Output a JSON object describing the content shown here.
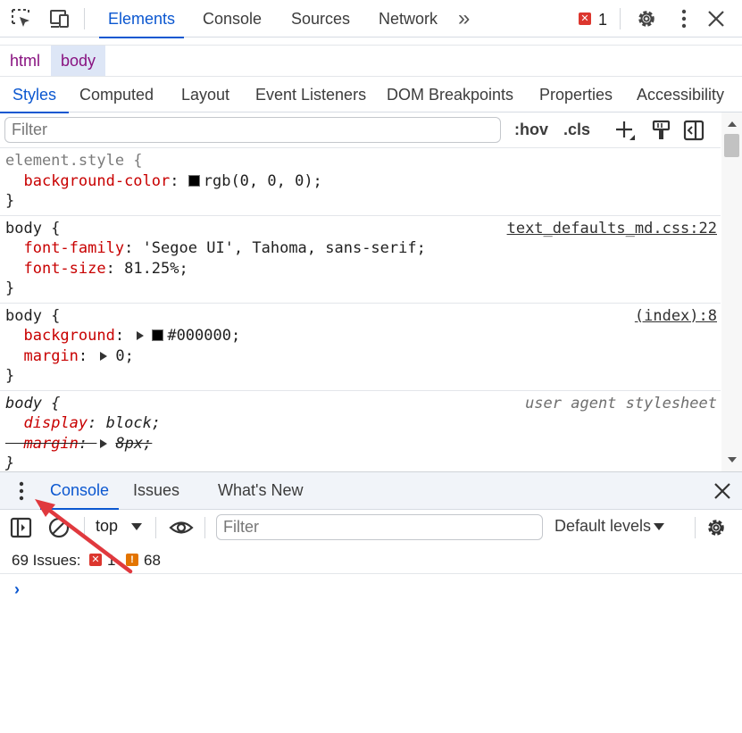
{
  "top_tabs": [
    "Elements",
    "Console",
    "Sources",
    "Network"
  ],
  "more_tabs_glyph": "»",
  "error_count": "1",
  "icons": {
    "inspect": "inspect-element-icon",
    "device": "device-toolbar-icon",
    "error": "error-badge-icon",
    "settings": "gear-icon",
    "menu": "kebab-menu-icon",
    "close": "close-icon"
  },
  "breadcrumb": [
    "html",
    "body"
  ],
  "sub_tabs": [
    "Styles",
    "Computed",
    "Layout",
    "Event Listeners",
    "DOM Breakpoints",
    "Properties",
    "Accessibility"
  ],
  "styles_filter": {
    "placeholder": "Filter",
    "hov": ":hov",
    "cls": ".cls"
  },
  "rules": [
    {
      "selector": "element.style {",
      "source": "",
      "props": [
        {
          "name": "background-color",
          "value": "rgb(0, 0, 0);",
          "swatch": "#000000"
        }
      ]
    },
    {
      "selector": "body {",
      "source": "text_defaults_md.css:22",
      "props": [
        {
          "name": "font-family",
          "value": "'Segoe UI', Tahoma, sans-serif;"
        },
        {
          "name": "font-size",
          "value": "81.25%;"
        }
      ]
    },
    {
      "selector": "body {",
      "source": "(index):8",
      "props": [
        {
          "name": "background",
          "value": "#000000;",
          "swatch": "#000000"
        },
        {
          "name": "margin",
          "value": "0;"
        }
      ]
    },
    {
      "selector": "body {",
      "source": "user agent stylesheet",
      "props": [
        {
          "name": "display",
          "value": "block;"
        },
        {
          "name": "margin",
          "value": "8px;",
          "overridden": true
        }
      ]
    }
  ],
  "closing_brace": "}",
  "drawer": {
    "tabs": [
      "Console",
      "Issues",
      "What's New"
    ],
    "context": "top",
    "filter_placeholder": "Filter",
    "levels": "Default levels",
    "issues_label": "69 Issues:",
    "issue_errors": "1",
    "issue_warnings": "68",
    "prompt_glyph": "›"
  },
  "colors": {
    "accent": "#0b57d0",
    "property": "#c80000",
    "tag": "#881280",
    "error": "#dc362e",
    "warning": "#e37400",
    "annotation_arrow": "#e0393e"
  }
}
